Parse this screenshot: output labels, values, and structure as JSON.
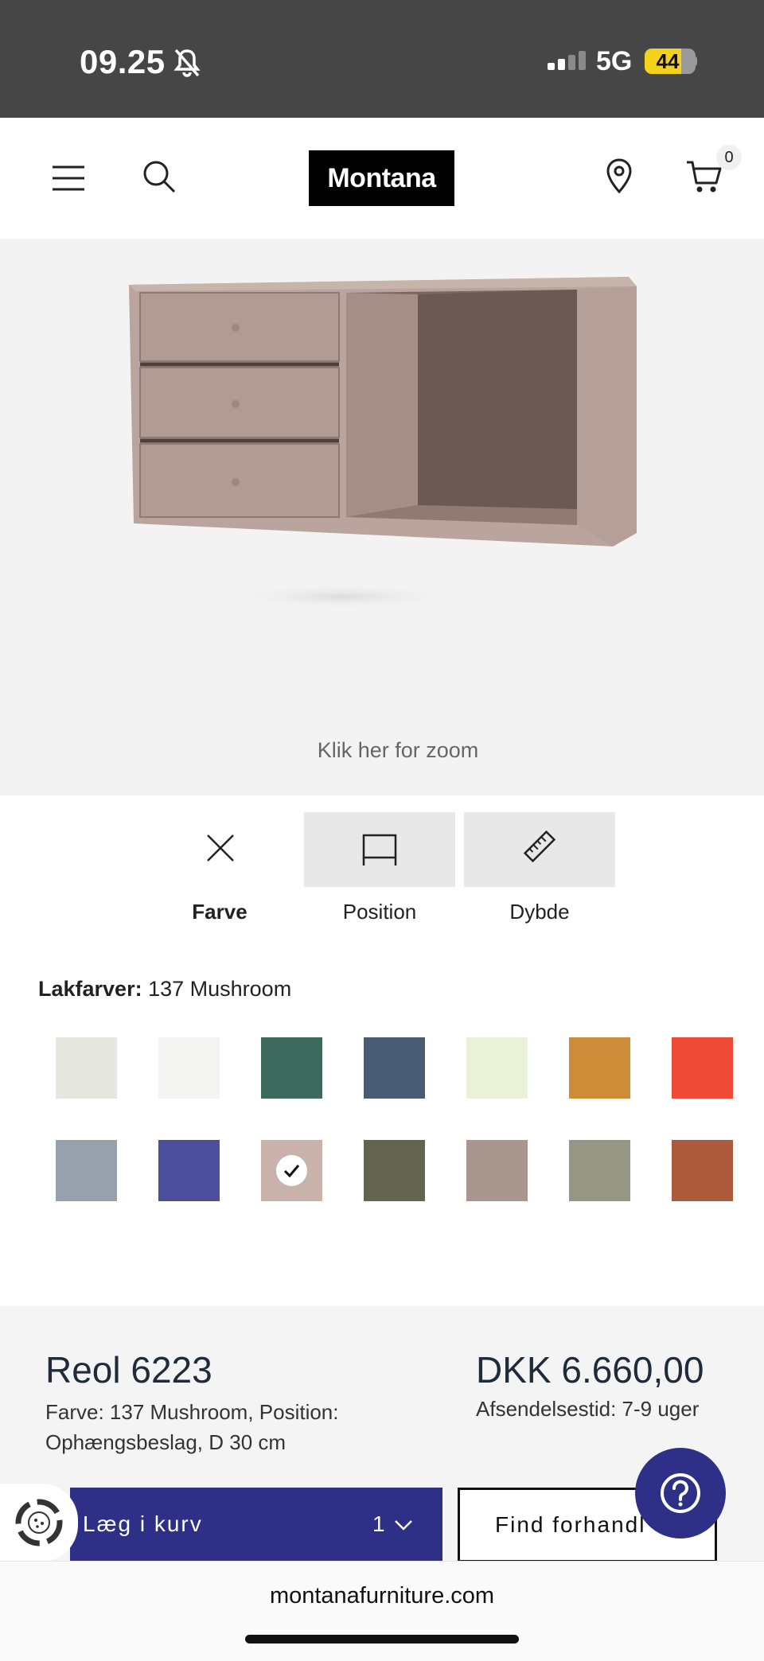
{
  "status_bar": {
    "time": "09.25",
    "network": "5G",
    "battery": "44"
  },
  "header": {
    "logo": "Montana",
    "cart_count": "0"
  },
  "product_image": {
    "zoom_hint": "Klik her for zoom"
  },
  "option_tabs": [
    {
      "label": "Farve",
      "icon": "close-icon",
      "active": true
    },
    {
      "label": "Position",
      "icon": "frame-icon",
      "active": false
    },
    {
      "label": "Dybde",
      "icon": "ruler-icon",
      "active": false
    }
  ],
  "color_section": {
    "label": "Lakfarver:",
    "selected": "137 Mushroom"
  },
  "swatches": [
    {
      "color": "#e6e7e1"
    },
    {
      "color": "#f4f4f3"
    },
    {
      "color": "#3e6a5e"
    },
    {
      "color": "#4a5b75"
    },
    {
      "color": "#e9f2d8"
    },
    {
      "color": "#cf8c38"
    },
    {
      "color": "#ee4a37"
    },
    {
      "color": "#98a0ad"
    },
    {
      "color": "#4b4f9e"
    },
    {
      "color": "#c9b2aa",
      "selected": true
    },
    {
      "color": "#636550"
    },
    {
      "color": "#a9968f"
    },
    {
      "color": "#979684"
    },
    {
      "color": "#ad5a3c"
    }
  ],
  "product": {
    "title": "Reol 6223",
    "subtitle": "Farve: 137 Mushroom, Position: Ophængsbeslag, D 30 cm",
    "price": "DKK 6.660,00",
    "shipping": "Afsendelsestid: 7-9 uger"
  },
  "actions": {
    "add_to_cart": "Læg i kurv",
    "quantity": "1",
    "find_dealer": "Find forhandl"
  },
  "browser": {
    "url": "montanafurniture.com"
  },
  "colors": {
    "accent": "#2e2f86",
    "status_bar": "#464646"
  }
}
